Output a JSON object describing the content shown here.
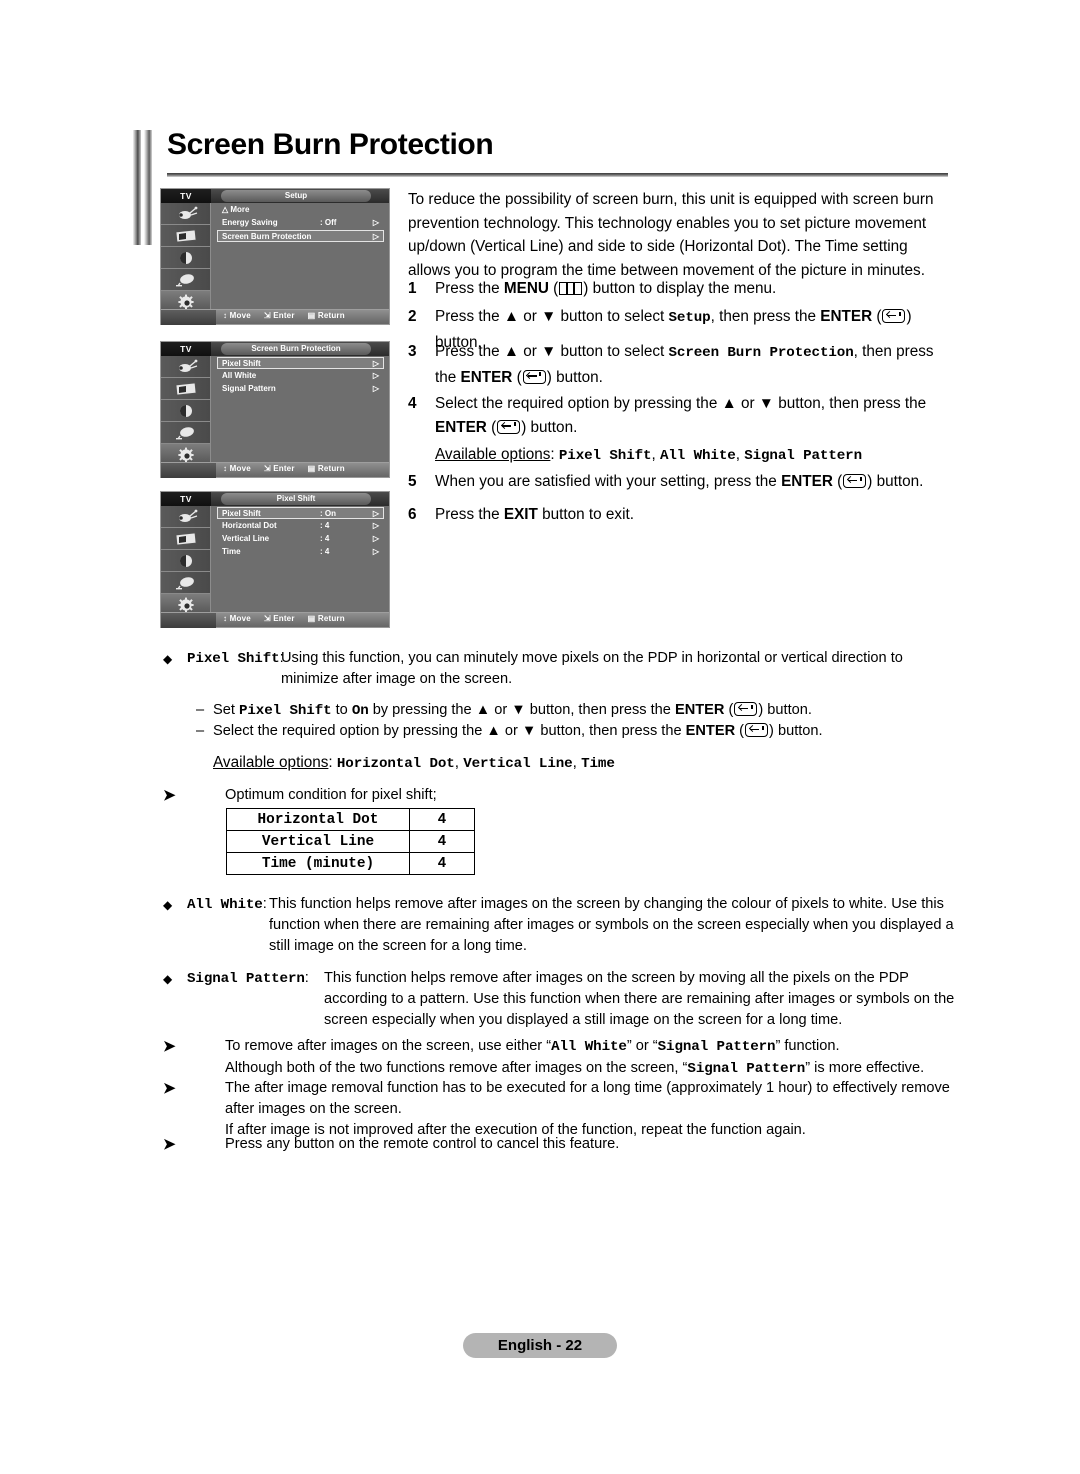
{
  "page": {
    "title": "Screen Burn Protection",
    "footer_label": "English - 22"
  },
  "osd_panels": [
    {
      "tv_label": "TV",
      "title": "Setup",
      "rows": [
        {
          "label": "More",
          "value": "",
          "arrow": false,
          "highlight": false,
          "is_more": true
        },
        {
          "label": "Energy Saving",
          "value": ": Off",
          "arrow": true,
          "highlight": false,
          "is_more": false
        },
        {
          "label": "Screen Burn Protection",
          "value": "",
          "arrow": true,
          "highlight": true,
          "is_more": false
        }
      ],
      "footer": {
        "move": "Move",
        "enter": "Enter",
        "return": "Return"
      }
    },
    {
      "tv_label": "TV",
      "title": "Screen Burn Protection",
      "rows": [
        {
          "label": "Pixel Shift",
          "value": "",
          "arrow": true,
          "highlight": true,
          "is_more": false
        },
        {
          "label": "All White",
          "value": "",
          "arrow": true,
          "highlight": false,
          "is_more": false
        },
        {
          "label": "Signal Pattern",
          "value": "",
          "arrow": true,
          "highlight": false,
          "is_more": false
        }
      ],
      "footer": {
        "move": "Move",
        "enter": "Enter",
        "return": "Return"
      }
    },
    {
      "tv_label": "TV",
      "title": "Pixel Shift",
      "rows": [
        {
          "label": "Pixel Shift",
          "value": ": On",
          "arrow": true,
          "highlight": true,
          "is_more": false
        },
        {
          "label": "Horizontal Dot",
          "value": ": 4",
          "arrow": true,
          "highlight": false,
          "is_more": false
        },
        {
          "label": "Vertical Line",
          "value": ": 4",
          "arrow": true,
          "highlight": false,
          "is_more": false
        },
        {
          "label": "Time",
          "value": ": 4",
          "arrow": true,
          "highlight": false,
          "is_more": false
        }
      ],
      "footer": {
        "move": "Move",
        "enter": "Enter",
        "return": "Return"
      }
    }
  ],
  "osd_sidebar_icons": [
    "input-source-icon",
    "picture-icon",
    "sound-icon",
    "channel-icon",
    "setup-gear-icon"
  ],
  "intro": {
    "paragraph": "To reduce the possibility of screen burn, this unit is equipped with screen burn prevention technology. This technology enables you to set picture movement up/down (Vertical Line) and side to side (Horizontal Dot). The Time setting allows you to program the time between movement of the picture in minutes."
  },
  "steps": [
    {
      "num": "1",
      "parts": [
        {
          "t": "text",
          "v": "Press the "
        },
        {
          "t": "bold",
          "v": "MENU"
        },
        {
          "t": "text",
          "v": " ("
        },
        {
          "t": "icon",
          "v": "menu-icon"
        },
        {
          "t": "text",
          "v": ") button to display the menu."
        }
      ]
    },
    {
      "num": "2",
      "parts": [
        {
          "t": "text",
          "v": "Press the ▲ or ▼ button to select "
        },
        {
          "t": "mono",
          "v": "Setup"
        },
        {
          "t": "text",
          "v": ", then press the "
        },
        {
          "t": "bold",
          "v": "ENTER"
        },
        {
          "t": "text",
          "v": " ("
        },
        {
          "t": "icon",
          "v": "enter-icon"
        },
        {
          "t": "text",
          "v": ") button."
        }
      ]
    },
    {
      "num": "3",
      "parts": [
        {
          "t": "text",
          "v": "Press the ▲ or ▼ button to select "
        },
        {
          "t": "mono",
          "v": "Screen Burn Protection"
        },
        {
          "t": "text",
          "v": ", then press the "
        },
        {
          "t": "bold",
          "v": "ENTER"
        },
        {
          "t": "text",
          "v": " ("
        },
        {
          "t": "icon",
          "v": "enter-icon"
        },
        {
          "t": "text",
          "v": ") button."
        }
      ]
    },
    {
      "num": "4",
      "parts": [
        {
          "t": "text",
          "v": "Select the required option by pressing the ▲ or ▼ button, then press the "
        },
        {
          "t": "bold",
          "v": "ENTER"
        },
        {
          "t": "text",
          "v": " ("
        },
        {
          "t": "icon",
          "v": "enter-icon"
        },
        {
          "t": "text",
          "v": ") button."
        }
      ]
    },
    {
      "num": "5",
      "parts": [
        {
          "t": "text",
          "v": "When you are satisfied with your setting, press the "
        },
        {
          "t": "bold",
          "v": "ENTER"
        },
        {
          "t": "text",
          "v": " ("
        },
        {
          "t": "icon",
          "v": "enter-icon"
        },
        {
          "t": "text",
          "v": ") button."
        }
      ]
    },
    {
      "num": "6",
      "parts": [
        {
          "t": "text",
          "v": "Press the "
        },
        {
          "t": "bold",
          "v": "EXIT"
        },
        {
          "t": "text",
          "v": " button to exit."
        }
      ]
    }
  ],
  "available_options_1": {
    "label": "Available options",
    "options": [
      "Pixel Shift",
      "All White",
      "Signal Pattern"
    ]
  },
  "available_options_2": {
    "label": "Available options",
    "options": [
      "Horizontal Dot",
      "Vertical Line",
      "Time"
    ]
  },
  "bullets": [
    {
      "term": "Pixel Shift",
      "colon": ":",
      "body": "Using this function, you can minutely move pixels on the PDP in horizontal or vertical direction to minimize after image on the screen."
    },
    {
      "term": "All White",
      "colon": ":",
      "body": "This function helps remove after images on the screen by changing the colour of pixels to white. Use this function when there are remaining after images or symbols on the screen especially when you displayed a still image on the screen for a long time."
    },
    {
      "term": "Signal Pattern",
      "colon": ":",
      "body": "This function helps remove after images on the screen by moving all the pixels on the PDP according to a pattern. Use this function when there are remaining after images or symbols on the screen especially when you displayed a still image on the screen for a long time."
    }
  ],
  "dash_lines": [
    {
      "parts": [
        {
          "t": "text",
          "v": "Set "
        },
        {
          "t": "mono",
          "v": "Pixel Shift"
        },
        {
          "t": "text",
          "v": " to "
        },
        {
          "t": "mono",
          "v": "On"
        },
        {
          "t": "text",
          "v": " by pressing the ▲ or ▼ button, then press the "
        },
        {
          "t": "bold",
          "v": "ENTER"
        },
        {
          "t": "text",
          "v": " ("
        },
        {
          "t": "icon",
          "v": "enter-icon"
        },
        {
          "t": "text",
          "v": ") button."
        }
      ]
    },
    {
      "parts": [
        {
          "t": "text",
          "v": "Select the required option by pressing the ▲ or ▼ button, then press the "
        },
        {
          "t": "bold",
          "v": "ENTER"
        },
        {
          "t": "text",
          "v": " ("
        },
        {
          "t": "icon",
          "v": "enter-icon"
        },
        {
          "t": "text",
          "v": ") button."
        }
      ]
    }
  ],
  "optimum": {
    "caption": "Optimum condition for pixel shift;",
    "rows": [
      {
        "key": "Horizontal Dot",
        "value": "4"
      },
      {
        "key": "Vertical Line",
        "value": "4"
      },
      {
        "key": "Time (minute)",
        "value": "4"
      }
    ]
  },
  "notes": [
    {
      "parts": [
        {
          "t": "text",
          "v": "To remove after images on the screen, use either “"
        },
        {
          "t": "mono",
          "v": "All White"
        },
        {
          "t": "text",
          "v": "” or “"
        },
        {
          "t": "mono",
          "v": "Signal Pattern"
        },
        {
          "t": "text",
          "v": "” function."
        },
        {
          "t": "br",
          "v": ""
        },
        {
          "t": "text",
          "v": "Although both of the two functions remove after images on the screen, “"
        },
        {
          "t": "mono",
          "v": "Signal Pattern"
        },
        {
          "t": "text",
          "v": "” is more effective."
        }
      ]
    },
    {
      "parts": [
        {
          "t": "text",
          "v": "The after image removal function has to be executed for a long time (approximately 1 hour) to effectively remove after images on the screen."
        },
        {
          "t": "br",
          "v": ""
        },
        {
          "t": "text",
          "v": "If after image is not improved after the execution of the function, repeat the function again."
        }
      ]
    },
    {
      "parts": [
        {
          "t": "text",
          "v": "Press any button on the remote control to cancel this feature."
        }
      ]
    }
  ]
}
